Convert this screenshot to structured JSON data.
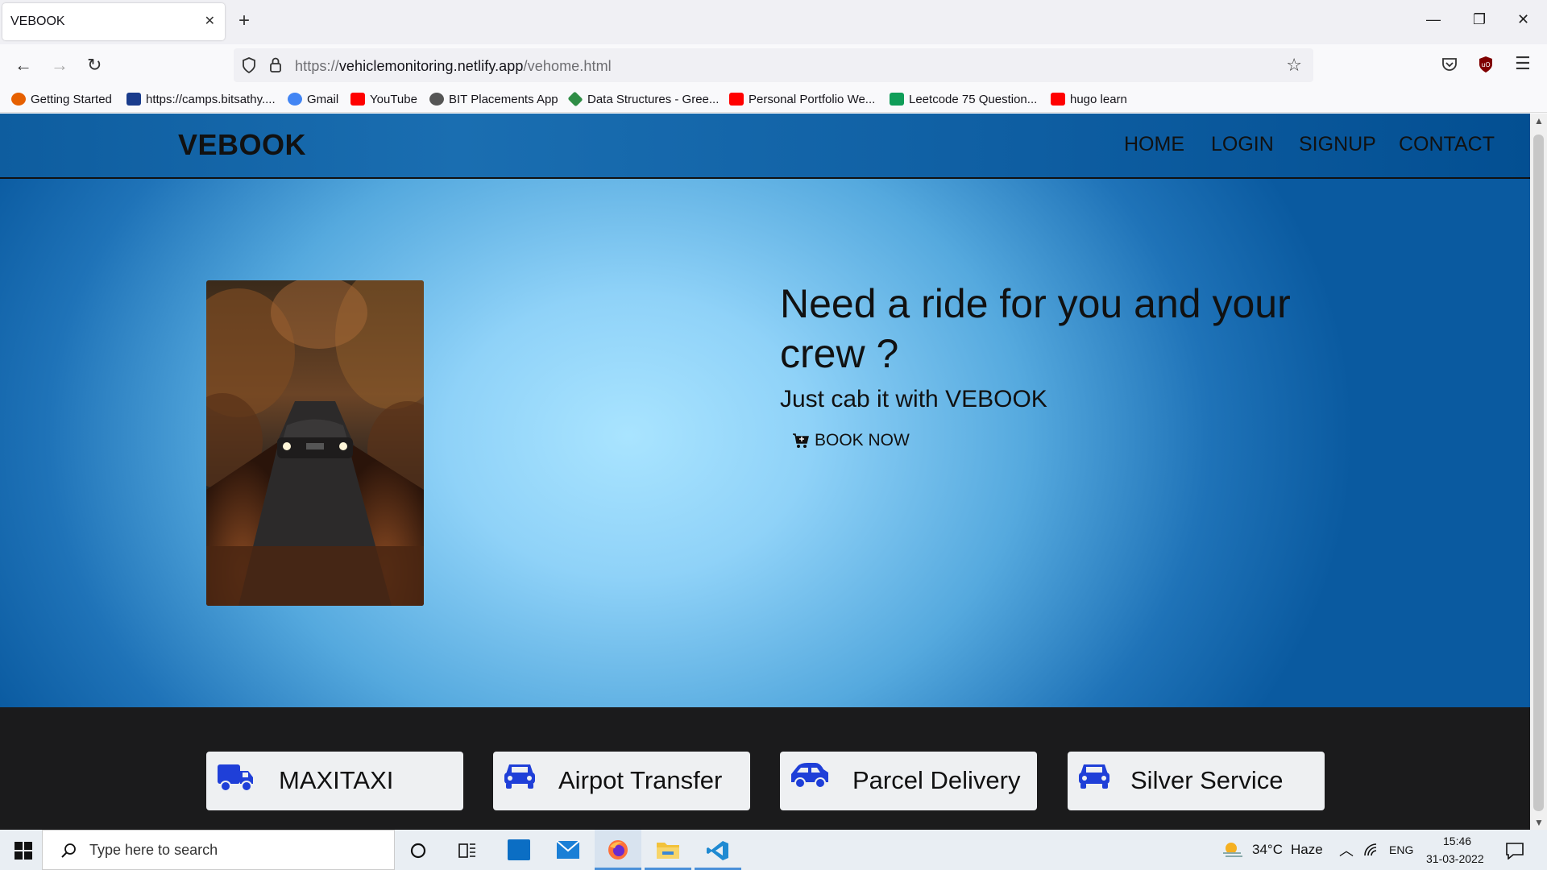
{
  "browser": {
    "tab_title": "VEBOOK",
    "url_prefix": "https://",
    "url_host": "vehiclemonitoring.netlify.app",
    "url_path": "/vehome.html",
    "bookmarks": [
      {
        "label": "Getting Started",
        "color": "#e66000"
      },
      {
        "label": "https://camps.bitsathy....",
        "color": "#1a3c8c"
      },
      {
        "label": "Gmail",
        "color": "#4285f4"
      },
      {
        "label": "YouTube",
        "color": "#ff0000"
      },
      {
        "label": "BIT Placements App",
        "color": "#555555"
      },
      {
        "label": "Data Structures - Gree...",
        "color": "#2f8d46"
      },
      {
        "label": "Personal Portfolio We...",
        "color": "#ff0000"
      },
      {
        "label": "Leetcode 75 Question...",
        "color": "#0f9d58"
      },
      {
        "label": "hugo learn",
        "color": "#ff0000"
      }
    ]
  },
  "site": {
    "logo": "VEBOOK",
    "nav": [
      "HOME",
      "LOGIN",
      "SIGNUP",
      "CONTACT"
    ],
    "hero_title": "Need a ride for you and your crew ?",
    "hero_subtitle": "Just cab it with VEBOOK",
    "cta_label": "BOOK NOW",
    "services": [
      {
        "label": "MAXITAXI",
        "icon": "truck-icon"
      },
      {
        "label": "Airpot Transfer",
        "icon": "car-icon"
      },
      {
        "label": "Parcel Delivery",
        "icon": "car-side-icon"
      },
      {
        "label": "Silver Service",
        "icon": "car-icon"
      }
    ],
    "accent_icon_color": "#1f3fd8"
  },
  "taskbar": {
    "search_placeholder": "Type here to search",
    "weather": "34°C",
    "weather_desc": "Haze",
    "language": "ENG",
    "time": "15:46",
    "date": "31-03-2022"
  }
}
